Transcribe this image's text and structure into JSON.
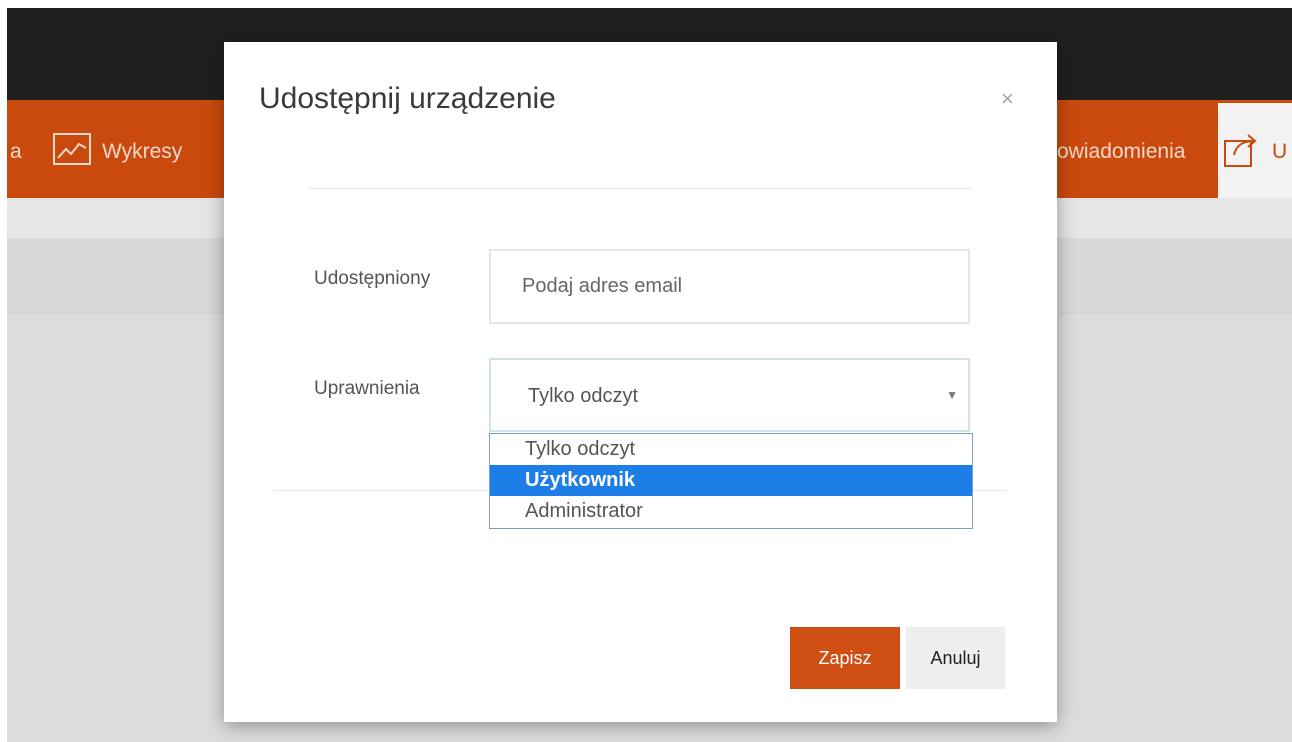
{
  "background": {
    "nav": {
      "items": [
        {
          "label": "a",
          "icon": "none"
        },
        {
          "label": "Wykresy",
          "icon": "chart-icon"
        },
        {
          "label": "owiadomienia",
          "icon": "none"
        },
        {
          "label": "U",
          "icon": "share-icon"
        }
      ]
    }
  },
  "modal": {
    "title": "Udostępnij urządzenie",
    "close_label": "×",
    "fields": {
      "shared": {
        "label": "Udostępniony",
        "placeholder": "Podaj adres email",
        "value": ""
      },
      "permissions": {
        "label": "Uprawnienia",
        "selected": "Tylko odczyt",
        "options": [
          "Tylko odczyt",
          "Użytkownik",
          "Administrator"
        ],
        "highlighted": "Użytkownik"
      }
    },
    "buttons": {
      "save": "Zapisz",
      "cancel": "Anuluj"
    }
  },
  "colors": {
    "accent": "#ca4a0d",
    "highlight": "#1e7ee8"
  }
}
